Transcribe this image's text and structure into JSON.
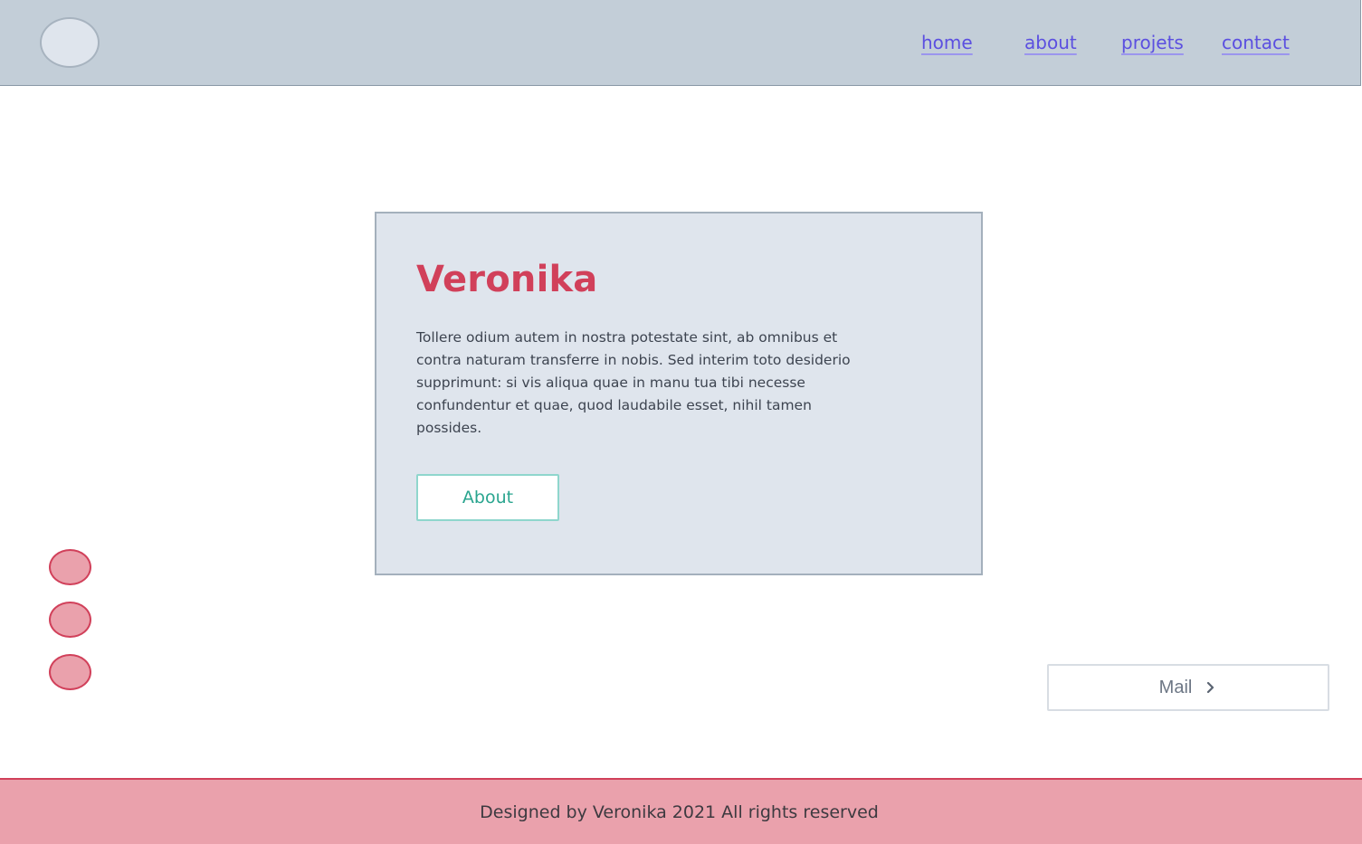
{
  "header": {
    "nav": [
      {
        "label": "home"
      },
      {
        "label": "about"
      },
      {
        "label": "projets"
      },
      {
        "label": "contact"
      }
    ]
  },
  "hero": {
    "title": "Veronika",
    "text": "Tollere odium autem in nostra potestate sint, ab omnibus et contra naturam transferre in nobis. Sed interim toto desiderio supprimunt: si vis aliqua quae in manu tua tibi necesse confundentur et quae, quod laudabile esset, nihil tamen possides.",
    "button_label": "About"
  },
  "mail_button": {
    "label": "Mail",
    "icon": "chevron-right-icon"
  },
  "footer": {
    "text": "Designed by Veronika 2021 All rights reserved"
  },
  "colors": {
    "header_bg": "#c3ced8",
    "card_bg": "#dfe5ed",
    "accent_red": "#d1405a",
    "accent_pink": "#eaa1ac",
    "accent_teal": "#2aa58f",
    "link": "#5b4fe0"
  }
}
